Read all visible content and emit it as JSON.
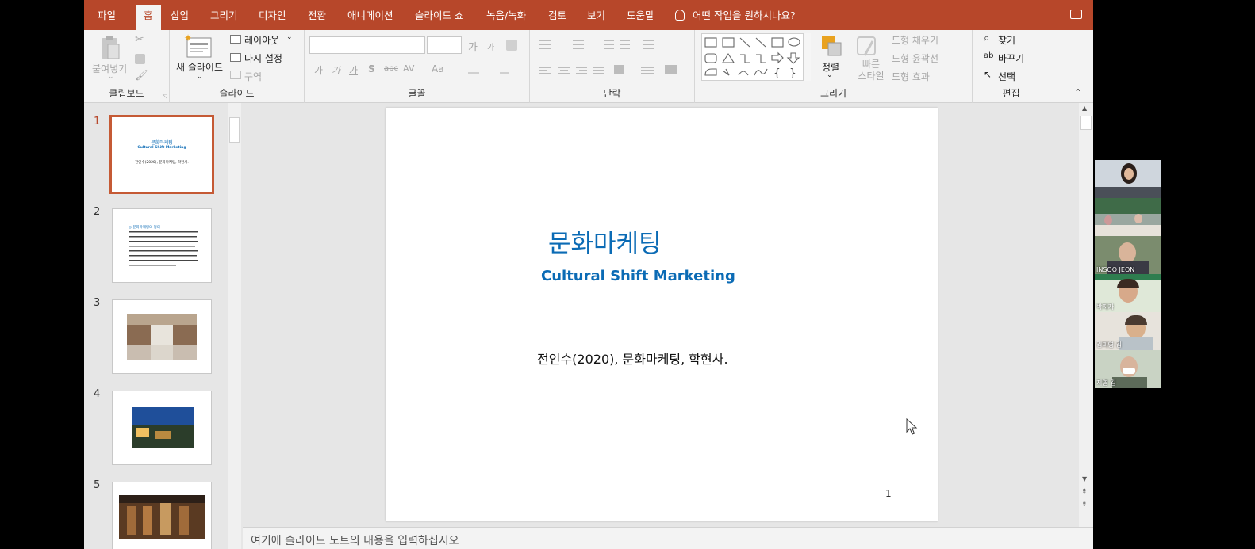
{
  "tabs": [
    "파일",
    "홈",
    "삽입",
    "그리기",
    "디자인",
    "전환",
    "애니메이션",
    "슬라이드 쇼",
    "녹음/녹화",
    "검토",
    "보기",
    "도움말"
  ],
  "active_tab": "홈",
  "tell_me": "어떤 작업을 원하시나요?",
  "ribbon": {
    "clipboard": {
      "paste": "붙여넣기",
      "label": "클립보드"
    },
    "slides": {
      "new_slide": "새 슬라이드",
      "layout": "레이아웃",
      "reset": "다시 설정",
      "section": "구역",
      "label": "슬라이드"
    },
    "font": {
      "label": "글꼴",
      "bold": "가",
      "italic": "가",
      "underline": "가",
      "shadow": "S",
      "strike": "abc",
      "spacing": "AV",
      "case": "Aa",
      "grow": "가",
      "shrink": "가"
    },
    "paragraph": {
      "label": "단락"
    },
    "drawing": {
      "arrange": "정렬",
      "quick_style": "빠른 스타일",
      "fill": "도형 채우기",
      "outline": "도형 윤곽선",
      "effects": "도형 효과",
      "label": "그리기"
    },
    "editing": {
      "find": "찾기",
      "replace": "바꾸기",
      "select": "선택",
      "label": "편집"
    }
  },
  "thumbnails": [
    {
      "num": "1",
      "title": "문화마케팅",
      "subtitle": "Cultural Shift Marketing",
      "line": "전인수(2020), 문화마케팅, 학현사."
    },
    {
      "num": "2",
      "title": "◎ 문화마케팅의 정의"
    },
    {
      "num": "3"
    },
    {
      "num": "4"
    },
    {
      "num": "5"
    }
  ],
  "slide": {
    "title": "문화마케팅",
    "subtitle": "Cultural Shift Marketing",
    "citation": "전인수(2020), 문화마케팅, 학현사.",
    "page_number": "1"
  },
  "notes_placeholder": "여기에 슬라이드 노트의 내용을 입력하십시오",
  "participants": [
    {
      "name": ""
    },
    {
      "name": ""
    },
    {
      "name": "INSOO JEON"
    },
    {
      "name": "박지자"
    },
    {
      "name": "김미영 김"
    },
    {
      "name": "지영 김"
    }
  ],
  "colors": {
    "accent": "#b7472a",
    "slide_blue": "#0b6bb5",
    "ribbon_bg": "#f3f3f3"
  }
}
